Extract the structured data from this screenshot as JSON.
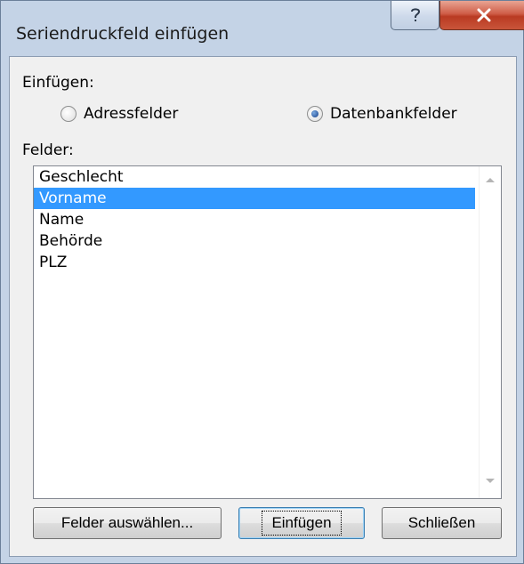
{
  "window": {
    "title": "Seriendruckfeld einfügen"
  },
  "einfuegen": {
    "label": "Einfügen:",
    "options": [
      {
        "label": "Adressfelder",
        "checked": false
      },
      {
        "label": "Datenbankfelder",
        "checked": true
      }
    ]
  },
  "felder": {
    "label": "Felder:",
    "items": [
      "Geschlecht",
      "Vorname",
      "Name",
      "Behörde",
      "PLZ"
    ],
    "selected": "Vorname"
  },
  "buttons": {
    "felder_auswaehlen": "Felder auswählen...",
    "einfuegen": "Einfügen",
    "schliessen": "Schließen"
  },
  "icons": {
    "help": "help-icon",
    "close": "close-icon"
  },
  "colors": {
    "selection": "#3399ff",
    "close_button": "#c9553a"
  }
}
